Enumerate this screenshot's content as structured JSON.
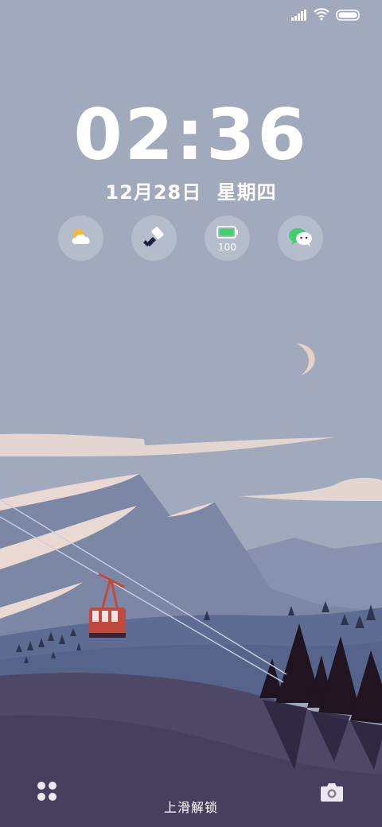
{
  "lockscreen": {
    "time": "02:36",
    "date": "12月28日",
    "weekday": "星期四",
    "unlock_hint": "上滑解锁"
  },
  "status_bar": {
    "icons": [
      "signal-icon",
      "wifi-icon",
      "battery-icon"
    ]
  },
  "widgets": [
    {
      "name": "weather",
      "icon": "partly-cloudy-icon"
    },
    {
      "name": "cleaner",
      "icon": "broom-icon"
    },
    {
      "name": "battery",
      "icon": "battery-icon",
      "label": "100",
      "level": 1.0
    },
    {
      "name": "wechat",
      "icon": "wechat-icon"
    }
  ],
  "bottom": {
    "left_icon": "apps-dots-icon",
    "right_icon": "camera-icon"
  },
  "colors": {
    "sky": "#a1a9bd",
    "battery_fill": "#3fd16b",
    "wechat_green": "#3fd16b",
    "gondola_red": "#c14a3e"
  }
}
